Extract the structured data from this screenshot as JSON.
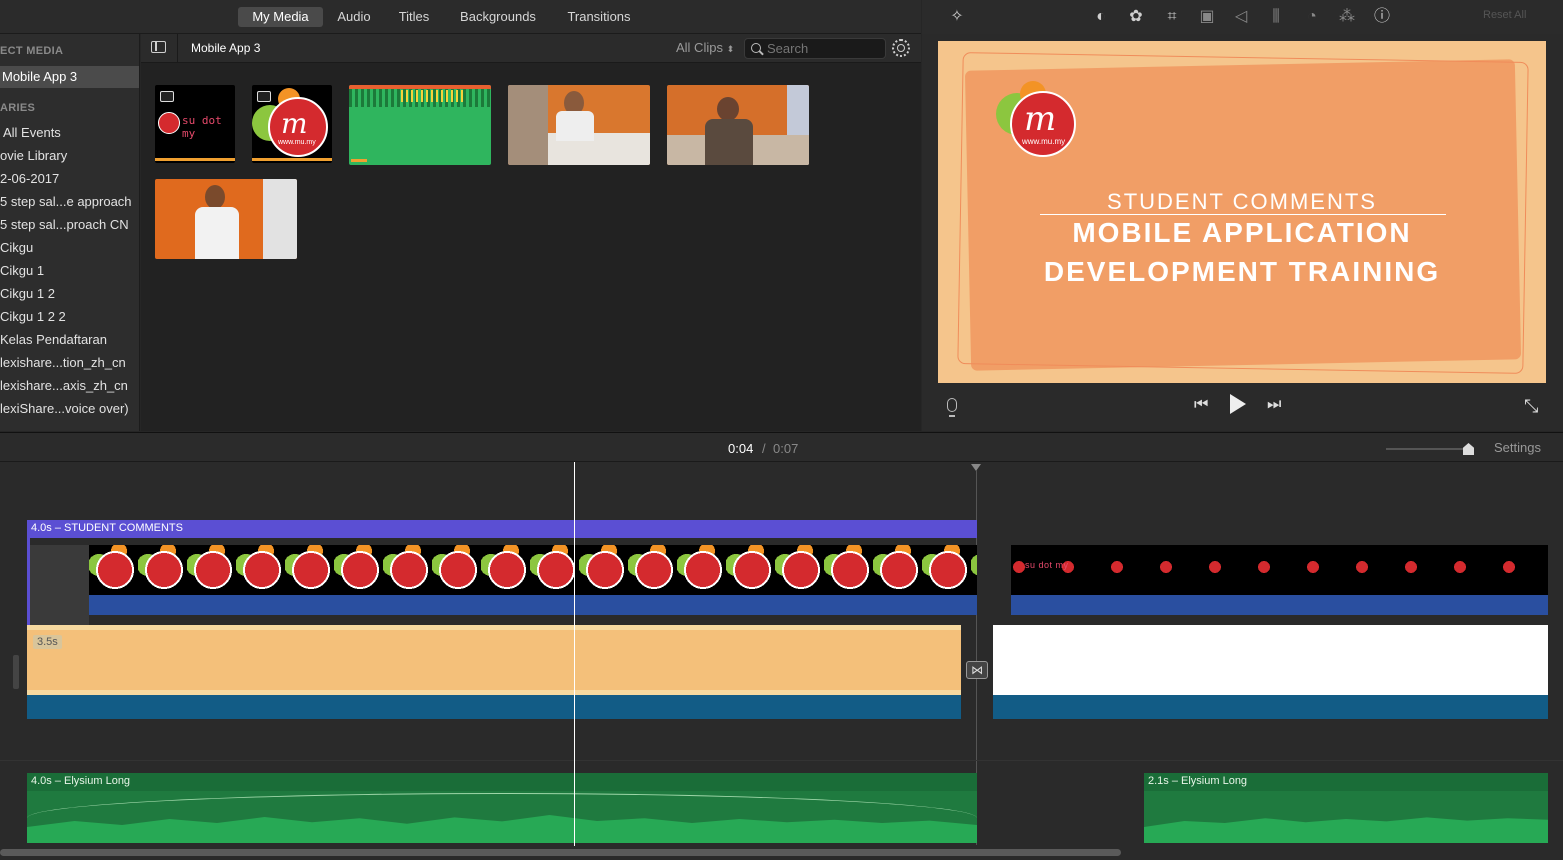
{
  "tabs": [
    {
      "label": "My Media"
    },
    {
      "label": "Audio"
    },
    {
      "label": "Titles"
    },
    {
      "label": "Backgrounds"
    },
    {
      "label": "Transitions"
    }
  ],
  "sidebar": {
    "project_media_heading": "ECT MEDIA",
    "project_item": "Mobile App 3",
    "libraries_heading": "ARIES",
    "items": [
      "All Events",
      "ovie Library",
      "2-06-2017",
      "5 step sal...e approach",
      "5 step sal...proach CN",
      "Cikgu",
      "Cikgu 1",
      "Cikgu 1 2",
      "Cikgu 1 2 2",
      "Kelas Pendaftaran",
      "lexishare...tion_zh_cn",
      "lexishare...axis_zh_cn",
      "lexiShare...voice over)"
    ]
  },
  "browser": {
    "title": "Mobile App 3",
    "filter": "All Clips",
    "search_placeholder": "Search",
    "thumb_text_1": "su dot my",
    "thumb_text_2": "www.mu.my"
  },
  "viewer": {
    "reset_label": "Reset All",
    "subtitle": "STUDENT COMMENTS",
    "title_line1": "MOBILE APPLICATION",
    "title_line2": "DEVELOPMENT TRAINING",
    "logo_url": "www.mu.my"
  },
  "timeline": {
    "current_time": "0:04",
    "separator": "/",
    "total_time": "0:07",
    "settings_label": "Settings",
    "title_clip_label": "4.0s – STUDENT COMMENTS",
    "bg_clip_duration": "3.5s",
    "audio1_label": "4.0s – Elysium Long",
    "audio2_label": "2.1s – Elysium Long",
    "strip_text": "su dot my"
  },
  "colors": {
    "accent_blue": "#5b4fd3",
    "title_bg": "#f6c98e",
    "audio_green": "#1f8a47",
    "clip_blue": "#2a4fa0",
    "video_orange": "#f0a06b"
  }
}
